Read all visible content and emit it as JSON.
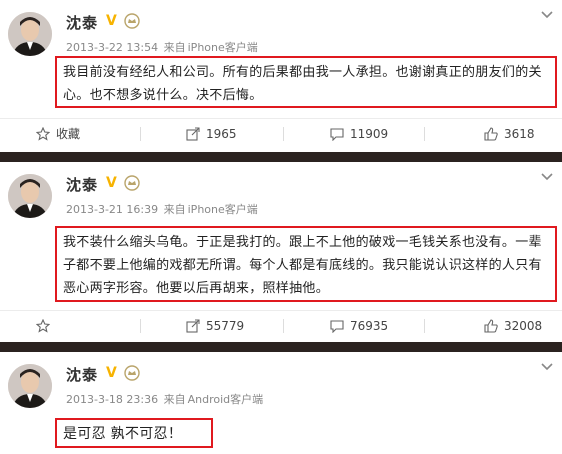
{
  "posts": [
    {
      "author": "沈泰",
      "verified_badge": "V",
      "time": "2013-3-22 13:54",
      "from_label": "来自",
      "client": "iPhone客户端",
      "content": "我目前没有经纪人和公司。所有的后果都由我一人承担。也谢谢真正的朋友们的关心。也不想多说什么。决不后悔。",
      "actions": {
        "favorite": "收藏",
        "share": "1965",
        "comment": "11909",
        "like": "3618"
      }
    },
    {
      "author": "沈泰",
      "verified_badge": "V",
      "time": "2013-3-21 16:39",
      "from_label": "来自",
      "client": "iPhone客户端",
      "content": "我不装什么缩头乌龟。于正是我打的。跟上不上他的破戏一毛钱关系也没有。一辈子都不要上他编的戏都无所谓。每个人都是有底线的。我只能说认识这样的人只有恶心两字形容。他要以后再胡来，照样抽他。",
      "actions": {
        "favorite": "",
        "share": "55779",
        "comment": "76935",
        "like": "32008"
      }
    },
    {
      "author": "沈泰",
      "verified_badge": "V",
      "time": "2013-3-18 23:36",
      "from_label": "来自",
      "client": "Android客户端",
      "content": "是可忍 孰不可忍！"
    }
  ],
  "colors": {
    "highlight_border": "#e0191f",
    "divider": "#2b2320",
    "badge": "#f7b300"
  },
  "icons": [
    "avatar",
    "verified-v-icon",
    "crown-icon",
    "chevron-down-icon",
    "star-icon",
    "share-icon",
    "comment-icon",
    "like-icon"
  ]
}
